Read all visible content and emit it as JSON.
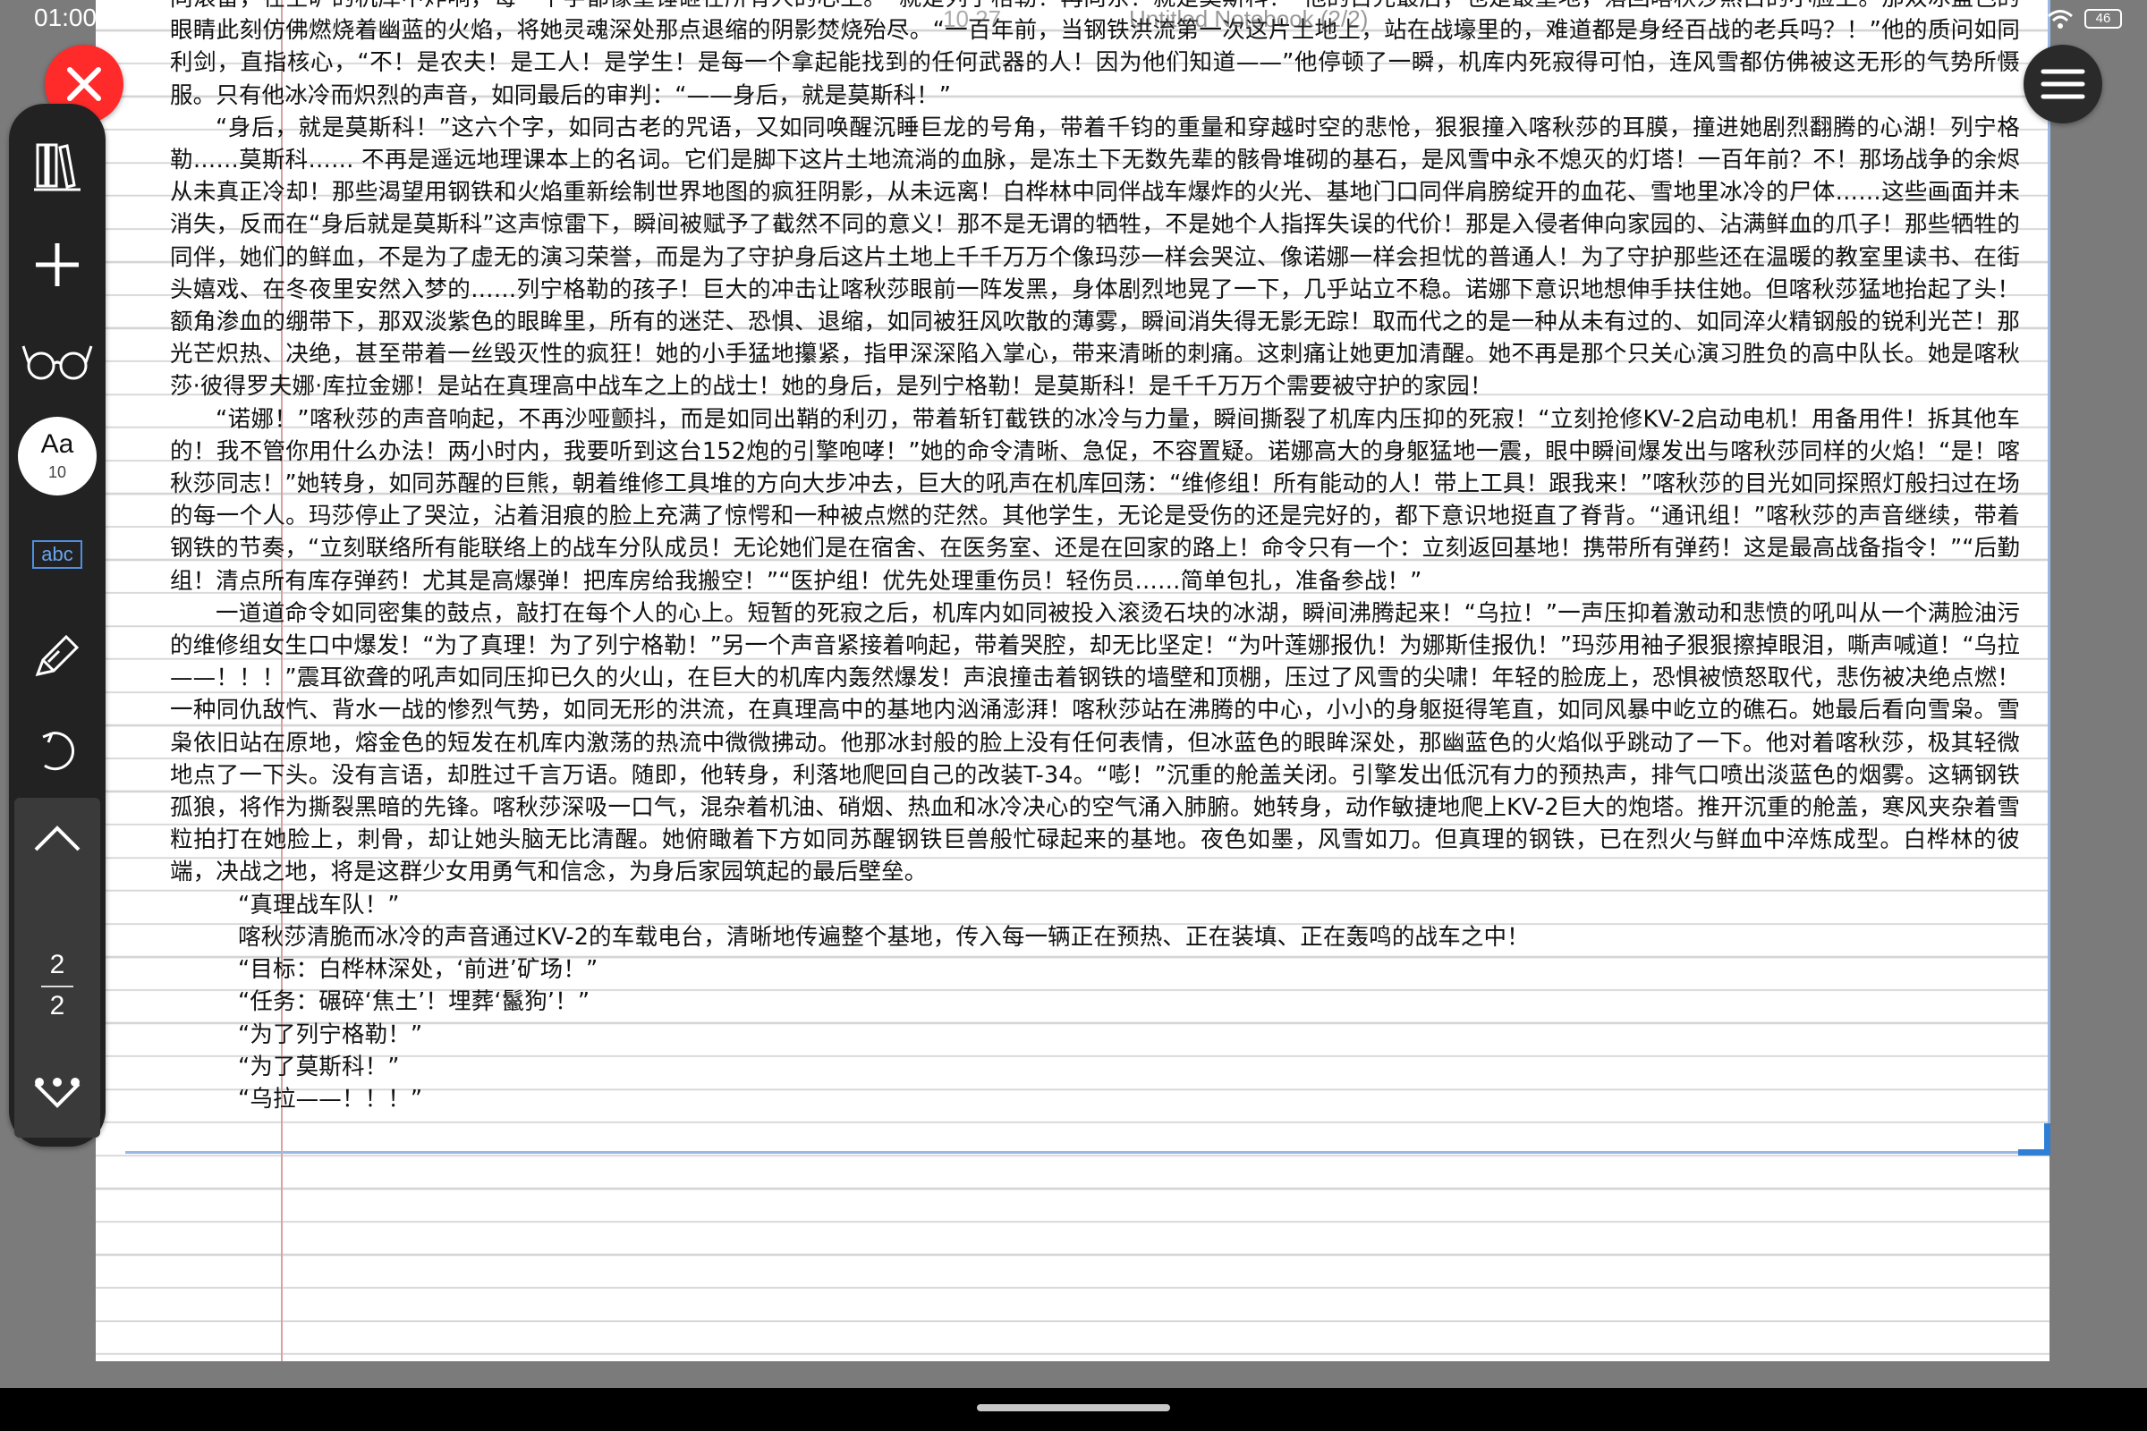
{
  "status_bar": {
    "time": "01:00",
    "notebook_title": "Untitled Notebook (2/2)",
    "page_indicator": "10   27",
    "battery": "46"
  },
  "toolbar": {
    "font_label": "Aa",
    "font_size": "10",
    "text_mode_badge": "abc",
    "page_current": "2",
    "page_total": "2"
  },
  "document": {
    "paragraphs": [
      "同滚雷，在空旷的机库中炸响，每一个字都像重锤砸在所有人的心上。“就是列宁格勒！再向东！就是莫斯科！”他的目光最后，也是最重地，落回喀秋莎煞白的小脸上。那双冰蓝色的眼睛此刻仿佛燃烧着幽蓝的火焰，将她灵魂深处那点退缩的阴影焚烧殆尽。“一百年前，当钢铁洪流第一次这片土地上，站在战壕里的，难道都是身经百战的老兵吗？！”他的质问如同利剑，直指核心，“不！是农夫！是工人！是学生！是每一个拿起能找到的任何武器的人！因为他们知道——”他停顿了一瞬，机库内死寂得可怕，连风雪都仿佛被这无形的气势所慑服。只有他冰冷而炽烈的声音，如同最后的审判：“——身后，就是莫斯科！”",
      "“身后，就是莫斯科！”这六个字，如同古老的咒语，又如同唤醒沉睡巨龙的号角，带着千钧的重量和穿越时空的悲怆，狠狠撞入喀秋莎的耳膜，撞进她剧烈翻腾的心湖！列宁格勒……莫斯科…… 不再是遥远地理课本上的名词。它们是脚下这片土地流淌的血脉，是冻土下无数先辈的骸骨堆砌的基石，是风雪中永不熄灭的灯塔！一百年前？不！那场战争的余烬从未真正冷却！那些渴望用钢铁和火焰重新绘制世界地图的疯狂阴影，从未远离！白桦林中同伴战车爆炸的火光、基地门口同伴肩膀绽开的血花、雪地里冰冷的尸体……这些画面并未消失，反而在“身后就是莫斯科”这声惊雷下，瞬间被赋予了截然不同的意义！那不是无谓的牺牲，不是她个人指挥失误的代价！那是入侵者伸向家园的、沾满鲜血的爪子！那些牺牲的同伴，她们的鲜血，不是为了虚无的演习荣誉，而是为了守护身后这片土地上千千万万个像玛莎一样会哭泣、像诺娜一样会担忧的普通人！为了守护那些还在温暖的教室里读书、在街头嬉戏、在冬夜里安然入梦的……列宁格勒的孩子！巨大的冲击让喀秋莎眼前一阵发黑，身体剧烈地晃了一下，几乎站立不稳。诺娜下意识地想伸手扶住她。但喀秋莎猛地抬起了头！额角渗血的绷带下，那双淡紫色的眼眸里，所有的迷茫、恐惧、退缩，如同被狂风吹散的薄雾，瞬间消失得无影无踪！取而代之的是一种从未有过的、如同淬火精钢般的锐利光芒！那光芒炽热、决绝，甚至带着一丝毁灭性的疯狂！她的小手猛地攥紧，指甲深深陷入掌心，带来清晰的刺痛。这刺痛让她更加清醒。她不再是那个只关心演习胜负的高中队长。她是喀秋莎·彼得罗夫娜·库拉金娜！是站在真理高中战车之上的战士！她的身后，是列宁格勒！是莫斯科！是千千万万个需要被守护的家园！",
      "“诺娜！”喀秋莎的声音响起，不再沙哑颤抖，而是如同出鞘的利刃，带着斩钉截铁的冰冷与力量，瞬间撕裂了机库内压抑的死寂！“立刻抢修KV-2启动电机！用备用件！拆其他车的！我不管你用什么办法！两小时内，我要听到这台152炮的引擎咆哮！”她的命令清晰、急促，不容置疑。诺娜高大的身躯猛地一震，眼中瞬间爆发出与喀秋莎同样的火焰！“是！喀秋莎同志！”她转身，如同苏醒的巨熊，朝着维修工具堆的方向大步冲去，巨大的吼声在机库回荡：“维修组！所有能动的人！带上工具！跟我来！”喀秋莎的目光如同探照灯般扫过在场的每一个人。玛莎停止了哭泣，沾着泪痕的脸上充满了惊愕和一种被点燃的茫然。其他学生，无论是受伤的还是完好的，都下意识地挺直了脊背。“通讯组！”喀秋莎的声音继续，带着钢铁的节奏，“立刻联络所有能联络上的战车分队成员！无论她们是在宿舍、在医务室、还是在回家的路上！命令只有一个：立刻返回基地！携带所有弹药！这是最高战备指令！”“后勤组！清点所有库存弹药！尤其是高爆弹！把库房给我搬空！”“医护组！优先处理重伤员！轻伤员……简单包扎，准备参战！”",
      "一道道命令如同密集的鼓点，敲打在每个人的心上。短暂的死寂之后，机库内如同被投入滚烫石块的冰湖，瞬间沸腾起来！“乌拉！”一声压抑着激动和悲愤的吼叫从一个满脸油污的维修组女生口中爆发！“为了真理！为了列宁格勒！”另一个声音紧接着响起，带着哭腔，却无比坚定！“为叶莲娜报仇！为娜斯佳报仇！”玛莎用袖子狠狠擦掉眼泪，嘶声喊道！“乌拉——！！！”震耳欲聋的吼声如同压抑已久的火山，在巨大的机库内轰然爆发！声浪撞击着钢铁的墙壁和顶棚，压过了风雪的尖啸！年轻的脸庞上，恐惧被愤怒取代，悲伤被决绝点燃！一种同仇敌忾、背水一战的惨烈气势，如同无形的洪流，在真理高中的基地内汹涌澎湃！喀秋莎站在沸腾的中心，小小的身躯挺得笔直，如同风暴中屹立的礁石。她最后看向雪枭。雪枭依旧站在原地，熔金色的短发在机库内激荡的热流中微微拂动。他那冰封般的脸上没有任何表情，但冰蓝色的眼眸深处，那幽蓝色的火焰似乎跳动了一下。他对着喀秋莎，极其轻微地点了一下头。没有言语，却胜过千言万语。随即，他转身，利落地爬回自己的改装T-34。“嘭！”沉重的舱盖关闭。引擎发出低沉有力的预热声，排气口喷出淡蓝色的烟雾。这辆钢铁孤狼，将作为撕裂黑暗的先锋。喀秋莎深吸一口气，混杂着机油、硝烟、热血和冰冷决心的空气涌入肺腑。她转身，动作敏捷地爬上KV-2巨大的炮塔。推开沉重的舱盖，寒风夹杂着雪粒拍打在她脸上，刺骨，却让她头脑无比清醒。她俯瞰着下方如同苏醒钢铁巨兽般忙碌起来的基地。夜色如墨，风雪如刀。但真理的钢铁，已在烈火与鲜血中淬炼成型。白桦林的彼端，决战之地，将是这群少女用勇气和信念，为身后家园筑起的最后壁垒。"
    ],
    "lines": [
      "“真理战车队！”",
      "喀秋莎清脆而冰冷的声音通过KV-2的车载电台，清晰地传遍整个基地，传入每一辆正在预热、正在装填、正在轰鸣的战车之中！",
      "“目标：白桦林深处，‘前进’矿场！”",
      "“任务：碾碎‘焦土’！埋葬‘鬣狗’！”",
      "“为了列宁格勒！”",
      "“为了莫斯科！”",
      "“乌拉——！！！”"
    ]
  },
  "colors": {
    "close_button": "#ff2b2b",
    "toolbar": "#222222",
    "accent_blue": "#2f7fd6",
    "margin_line": "#d6a3a3"
  },
  "icons": {
    "close": "x-icon",
    "menu": "hamburger-icon",
    "library": "library-icon",
    "add": "plus-icon",
    "reading": "glasses-icon",
    "font": "font-icon",
    "text_mode": "abc-icon",
    "pen": "pen-icon",
    "undo": "undo-icon",
    "page_up": "chevron-up-icon",
    "page_down": "chevron-down-icon",
    "more": "more-icon"
  }
}
